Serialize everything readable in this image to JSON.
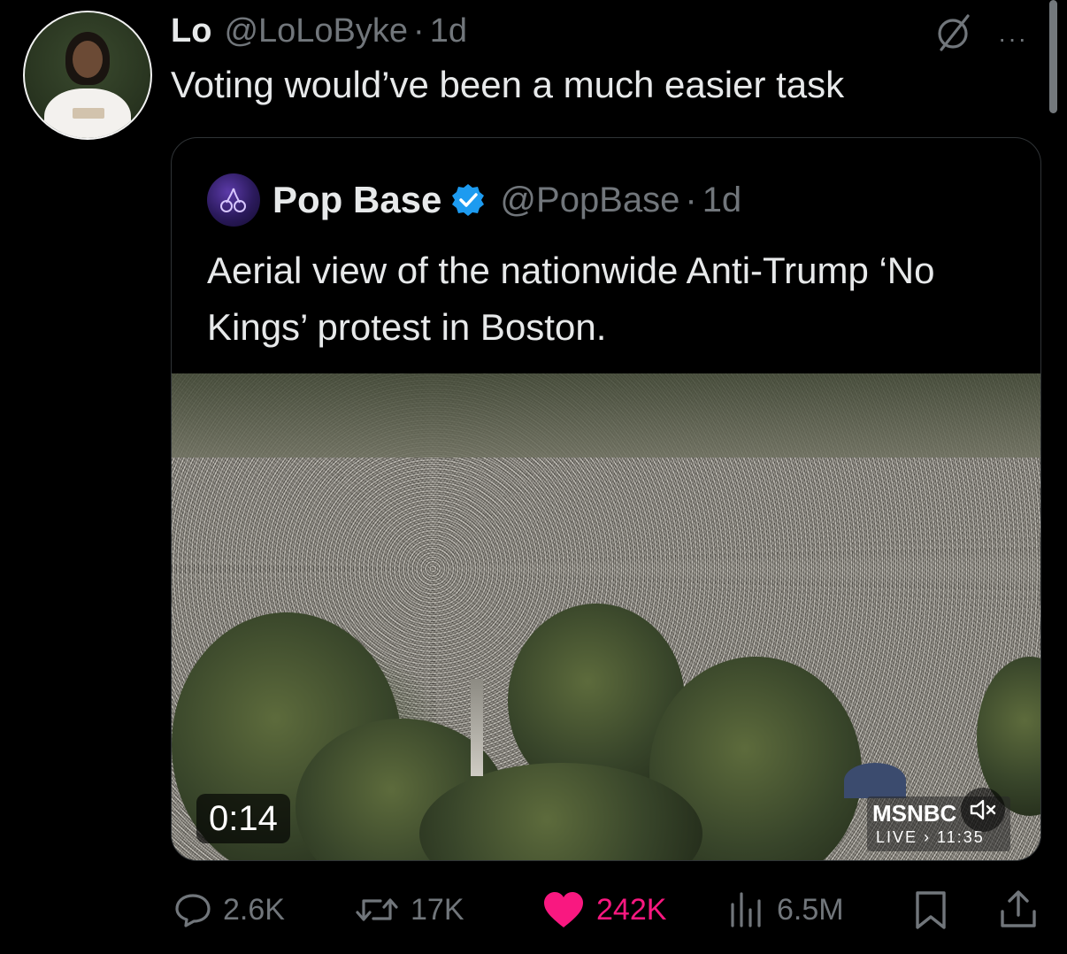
{
  "tweet": {
    "author_name": "Lo",
    "author_handle": "@LoLoByke",
    "separator": "·",
    "time": "1d",
    "text": "Voting would’ve been a much easier task",
    "more_label": "···"
  },
  "quote": {
    "author_name": "Pop Base",
    "author_handle": "@PopBase",
    "separator": "·",
    "time": "1d",
    "verified": true,
    "text": "Aerial view of the nationwide Anti-Trump ‘No Kings’ protest in Boston.",
    "video": {
      "duration": "0:14",
      "overlay_logo": "MSNBC",
      "overlay_live": "LIVE › 11:35",
      "muted": true
    }
  },
  "actions": {
    "replies": "2.6K",
    "reposts": "17K",
    "likes": "242K",
    "views": "6.5M",
    "liked": true
  },
  "colors": {
    "background": "#000000",
    "text": "#e7e9ea",
    "muted": "#71767b",
    "like": "#f91880",
    "verified": "#1d9bf0",
    "border": "#2f3336"
  },
  "icons": {
    "grok": "grok-slash-icon",
    "more": "more-horizontal-icon",
    "verified": "verified-badge-icon",
    "mute": "speaker-muted-icon",
    "reply": "reply-bubble-icon",
    "repost": "repost-icon",
    "like": "heart-filled-icon",
    "views": "views-bar-chart-icon",
    "bookmark": "bookmark-icon",
    "share": "share-upload-icon"
  }
}
